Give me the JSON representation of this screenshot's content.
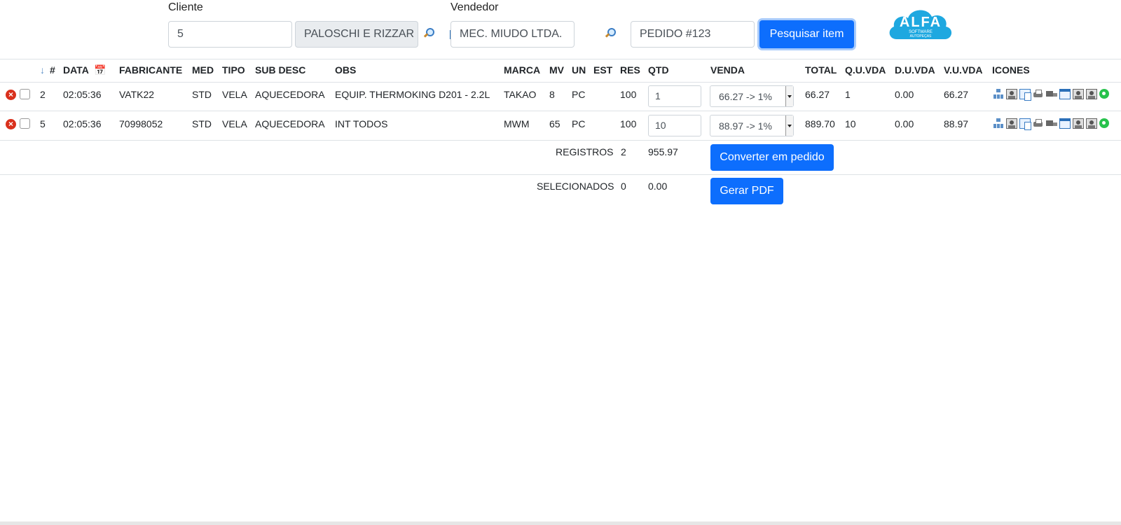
{
  "search": {
    "cliente_label": "Cliente",
    "cliente_value": "5",
    "cliente_name": "PALOSCHI E RIZZAR",
    "vendedor_label": "Vendedor",
    "vendedor_value": "MEC. MIUDO LTDA.",
    "pedido_value": "PEDIDO #123",
    "search_button": "Pesquisar item"
  },
  "logo": {
    "text": "ALFA",
    "subtitle1": "SOFTWARE",
    "subtitle2": "AUTOPEÇAS"
  },
  "table": {
    "headers": {
      "num": "#",
      "data": "DATA",
      "fabricante": "FABRICANTE",
      "med": "MED",
      "tipo": "TIPO",
      "subdesc": "SUB DESC",
      "obs": "OBS",
      "marca": "MARCA",
      "mv": "MV",
      "un": "UN",
      "est": "EST",
      "res": "RES",
      "qtd": "QTD",
      "venda": "VENDA",
      "total": "TOTAL",
      "quvda": "Q.U.VDA",
      "duvda": "D.U.VDA",
      "vuvda": "V.U.VDA",
      "icones": "ICONES"
    },
    "rows": [
      {
        "num": "2",
        "data": "02:05:36",
        "fabricante": "VATK22",
        "med": "STD",
        "tipo": "VELA",
        "subdesc": "AQUECEDORA",
        "obs": "EQUIP. THERMOKING D201 - 2.2L",
        "marca": "TAKAO",
        "mv": "8",
        "un": "PC",
        "est": "",
        "res": "100",
        "qtd": "1",
        "venda": "66.27 -> 1%",
        "total": "66.27",
        "quvda": "1",
        "duvda": "0.00",
        "vuvda": "66.27"
      },
      {
        "num": "5",
        "data": "02:05:36",
        "fabricante": "70998052",
        "med": "STD",
        "tipo": "VELA",
        "subdesc": "AQUECEDORA",
        "obs": "INT TODOS",
        "marca": "MWM",
        "mv": "65",
        "un": "PC",
        "est": "",
        "res": "100",
        "qtd": "10",
        "venda": "88.97 -> 1%",
        "total": "889.70",
        "quvda": "10",
        "duvda": "0.00",
        "vuvda": "88.97"
      }
    ]
  },
  "summary": {
    "registros_label": "REGISTROS",
    "registros_count": "2",
    "registros_total": "955.97",
    "convert_button": "Converter em pedido",
    "selecionados_label": "SELECIONADOS",
    "selecionados_count": "0",
    "selecionados_total": "0.00",
    "pdf_button": "Gerar PDF"
  },
  "colors": {
    "primary": "#0d6efd",
    "delete": "#d9301c",
    "logo": "#1ea8e0"
  },
  "icons": [
    "structure-icon",
    "photo-icon",
    "copy-icon",
    "print-icon",
    "truck-icon",
    "window-icon",
    "photo-icon",
    "photo-icon",
    "whatsapp-icon"
  ]
}
